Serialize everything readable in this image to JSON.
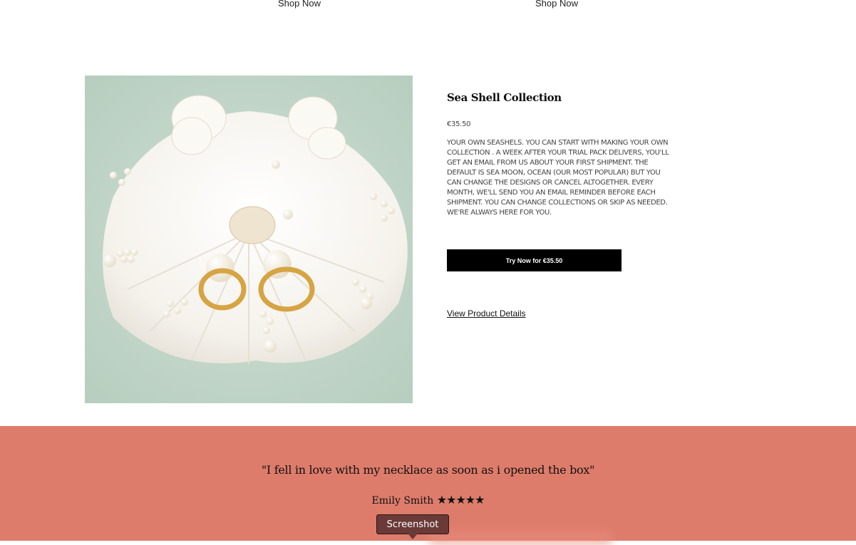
{
  "top_links": {
    "shop_now_1": "Shop Now",
    "shop_now_2": "Shop Now"
  },
  "product": {
    "title": "Sea Shell Collection",
    "price": "€35.50",
    "description": "YOUR OWN SEASHELS. YOU CAN START WITH MAKING YOUR OWN COLLECTION . A WEEK AFTER YOUR TRIAL PACK DELIVERS, YOU'LL GET AN EMAIL FROM US ABOUT YOUR FIRST SHIPMENT. THE DEFAULT IS SEA MOON, OCEAN (OUR MOST POPULAR) BUT YOU CAN CHANGE THE DESIGNS OR CANCEL ALTOGETHER. EVERY MONTH, WE'LL SEND YOU AN EMAIL REMINDER BEFORE EACH SHIPMENT. YOU CAN CHANGE COLLECTIONS OR SKIP AS NEEDED. WE'RE ALWAYS HERE FOR YOU.",
    "try_button": "Try Now for €35.50",
    "details_link": "View Product Details"
  },
  "testimonial": {
    "quote": "\"I fell in love with my necklace as soon as i opened the box\"",
    "author": "Emily Smith",
    "stars": "★★★★★",
    "rating": 5
  },
  "overlay": {
    "screenshot_label": "Screenshot"
  },
  "colors": {
    "band": "#de7c6b",
    "button": "#000000",
    "tooltip": "#6a3a38"
  }
}
